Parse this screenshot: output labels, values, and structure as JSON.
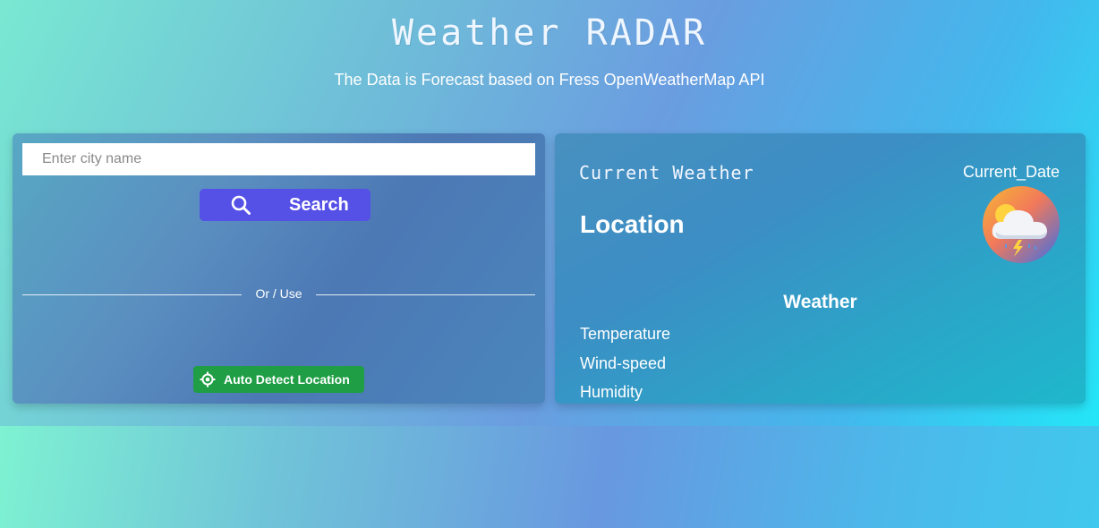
{
  "header": {
    "title": "Weather RADAR",
    "subtitle": "The Data is Forecast based on Fress OpenWeatherMap API"
  },
  "search_panel": {
    "city_input": {
      "placeholder": "Enter city name",
      "value": ""
    },
    "search_button": {
      "label": "Search",
      "icon": "search-icon",
      "color": "#5550e6"
    },
    "divider_text": "Or / Use",
    "auto_detect_button": {
      "label": "Auto Detect Location",
      "icon": "crosshair-icon",
      "color": "#1f9e45"
    }
  },
  "weather_panel": {
    "heading": "Current Weather",
    "date": "Current_Date",
    "location": "Location",
    "icon": "thunderstorm-cloud-icon",
    "section_title": "Weather",
    "stats": {
      "temperature_label": "Temperature",
      "wind_speed_label": "Wind-speed",
      "humidity_label": "Humidity"
    }
  }
}
